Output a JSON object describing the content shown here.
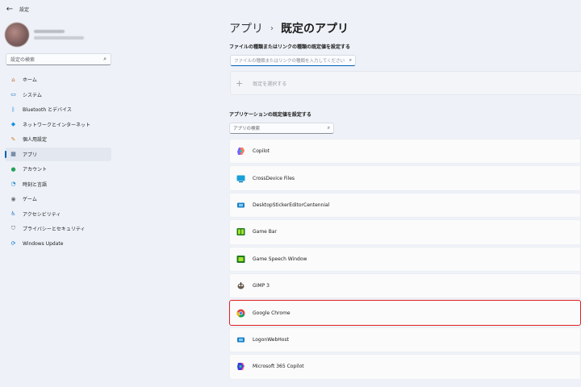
{
  "window": {
    "title": "設定",
    "back_glyph": "←"
  },
  "sidebar": {
    "search_placeholder": "設定の検索",
    "items": [
      {
        "label": "ホーム",
        "icon": "home-icon",
        "color": "#c06a2b"
      },
      {
        "label": "システム",
        "icon": "system-icon",
        "color": "#0067c0"
      },
      {
        "label": "Bluetooth とデバイス",
        "icon": "bluetooth-icon",
        "color": "#0078d4"
      },
      {
        "label": "ネットワークとインターネット",
        "icon": "network-icon",
        "color": "#1a8fe3"
      },
      {
        "label": "個人用設定",
        "icon": "brush-icon",
        "color": "#d9822b"
      },
      {
        "label": "アプリ",
        "icon": "apps-icon",
        "color": "#3c5a80",
        "active": true
      },
      {
        "label": "アカウント",
        "icon": "account-icon",
        "color": "#2aa05a"
      },
      {
        "label": "時刻と言語",
        "icon": "time-language-icon",
        "color": "#1b89c9"
      },
      {
        "label": "ゲーム",
        "icon": "gaming-icon",
        "color": "#6b6f76"
      },
      {
        "label": "アクセシビリティ",
        "icon": "accessibility-icon",
        "color": "#1a73c8"
      },
      {
        "label": "プライバシーとセキュリティ",
        "icon": "shield-icon",
        "color": "#6b6f76"
      },
      {
        "label": "Windows Update",
        "icon": "windows-update-icon",
        "color": "#0a74d6"
      }
    ]
  },
  "main": {
    "breadcrumb": {
      "parent": "アプリ",
      "separator": "›",
      "current": "既定のアプリ"
    },
    "filetype_section": {
      "label": "ファイルの種類またはリンクの種類の既定値を設定する",
      "search_placeholder": "ファイルの種類またはリンクの種類を入力してください",
      "choose_default_plus": "+",
      "choose_default_label": "既定を選択する"
    },
    "apps_section": {
      "label": "アプリケーションの既定値を設定する",
      "search_placeholder": "アプリの検索",
      "apps": [
        {
          "name": "Copilot",
          "icon": "copilot-icon"
        },
        {
          "name": "CrossDevice Files",
          "icon": "crossdevice-icon"
        },
        {
          "name": "DesktopStickerEditorCentennial",
          "icon": "sticker-editor-icon"
        },
        {
          "name": "Game Bar",
          "icon": "game-bar-icon"
        },
        {
          "name": "Game Speech Window",
          "icon": "game-speech-icon"
        },
        {
          "name": "GIMP 3",
          "icon": "gimp-icon"
        },
        {
          "name": "Google Chrome",
          "icon": "chrome-icon",
          "highlighted": true
        },
        {
          "name": "LogonWebHost",
          "icon": "logon-webhost-icon"
        },
        {
          "name": "Microsoft 365 Copilot",
          "icon": "m365-copilot-icon"
        }
      ]
    }
  },
  "colors": {
    "accent": "#005fb8",
    "highlight": "#e21f1f"
  },
  "search_glyph": "⌕"
}
